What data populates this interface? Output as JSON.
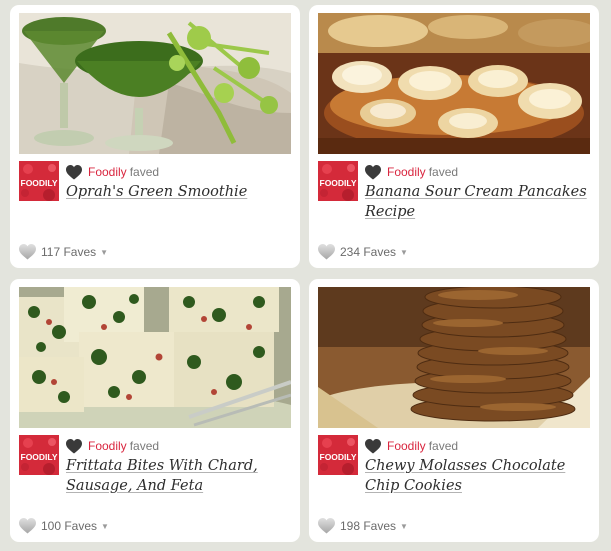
{
  "colors": {
    "page_background": "#e3e4dd",
    "card_background": "#ffffff",
    "faver_link": "#d9263f",
    "brand_avatar": "#d42a3a"
  },
  "cards": [
    {
      "faver": "Foodily",
      "action": "faved",
      "title": "Oprah's Green Smoothie",
      "faves_count": "117 Faves",
      "avatar_text": "FOODILY"
    },
    {
      "faver": "Foodily",
      "action": "faved",
      "title": "Banana Sour Cream Pancakes Recipe",
      "faves_count": "234 Faves",
      "avatar_text": "FOODILY"
    },
    {
      "faver": "Foodily",
      "action": "faved",
      "title": "Frittata Bites With Chard, Sausage, And Feta",
      "faves_count": "100 Faves",
      "avatar_text": "FOODILY"
    },
    {
      "faver": "Foodily",
      "action": "faved",
      "title": "Chewy Molasses Chocolate Chip Cookies",
      "faves_count": "198 Faves",
      "avatar_text": "FOODILY"
    }
  ],
  "icons": {
    "faved_heart": "dark-heart-icon",
    "faves_heart": "grey-heart-icon",
    "dropdown": "caret-down-icon"
  }
}
